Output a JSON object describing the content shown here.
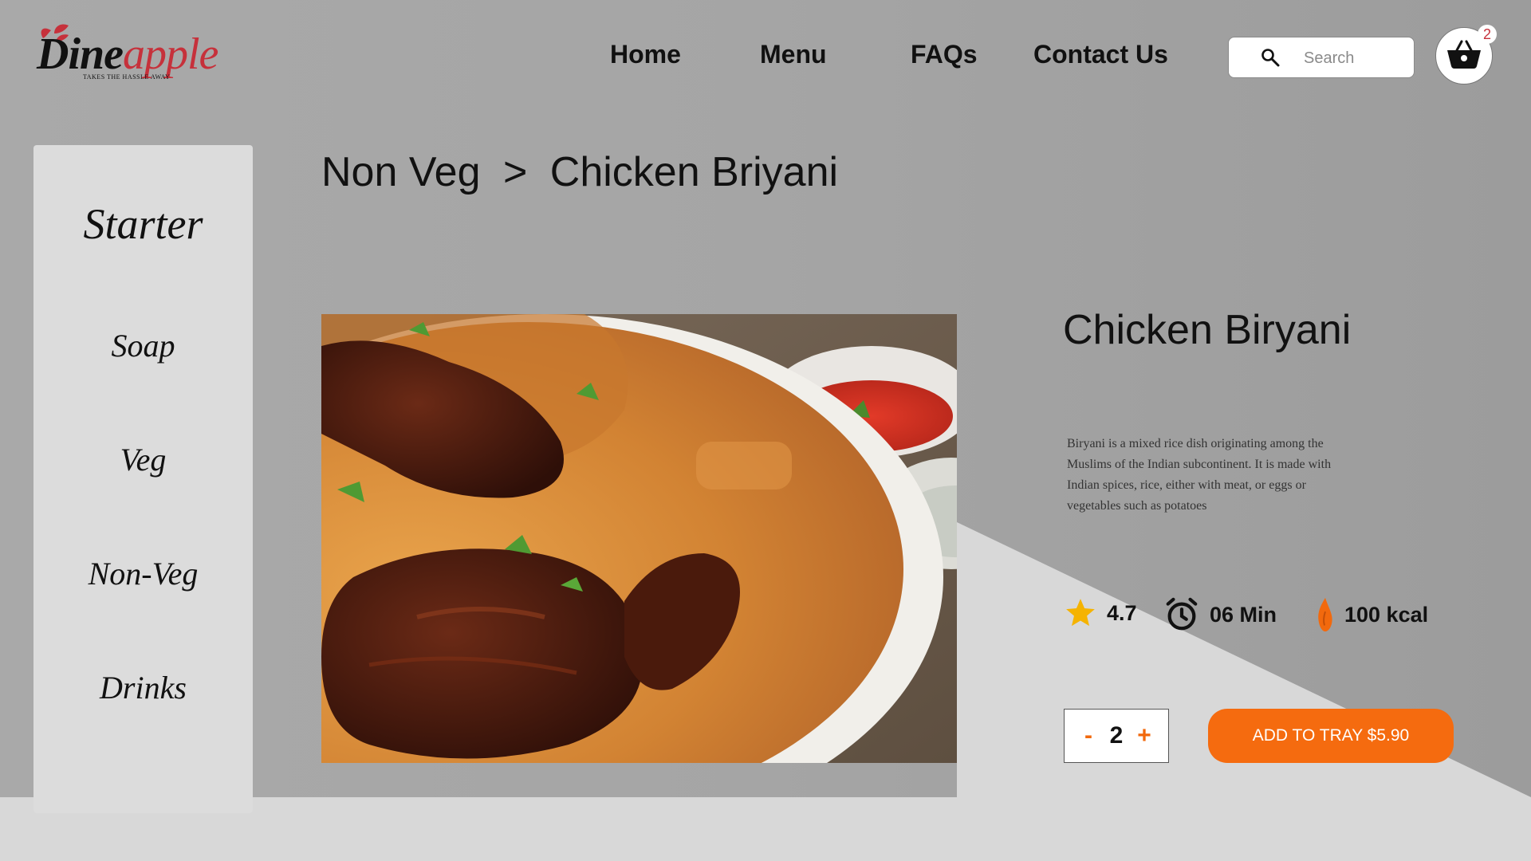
{
  "brand": {
    "name_part1": "Dine",
    "name_part2": "apple",
    "tagline": "TAKES THE HASSLE AWAY",
    "accent_color": "#c6313b"
  },
  "nav": {
    "items": [
      {
        "label": "Home"
      },
      {
        "label": "Menu"
      },
      {
        "label": "FAQs"
      },
      {
        "label": "Contact Us"
      }
    ]
  },
  "search": {
    "placeholder": "Search",
    "value": "",
    "icon": "search-icon"
  },
  "cart": {
    "icon": "basket-icon",
    "count": "2"
  },
  "sidebar": {
    "items": [
      {
        "label": "Starter"
      },
      {
        "label": "Soap"
      },
      {
        "label": "Veg"
      },
      {
        "label": "Non-Veg"
      },
      {
        "label": "Drinks"
      }
    ]
  },
  "breadcrumb": {
    "parent": "Non Veg",
    "separator": ">",
    "current": "Chicken Briyani"
  },
  "dish": {
    "name": "Chicken Biryani",
    "description": "Biryani is a mixed rice dish originating among the Muslims of the Indian subcontinent. It is made with Indian spices, rice, either with meat, or eggs or vegetables such as potatoes",
    "image_alt": "Chicken Biryani plate",
    "rating": "4.7",
    "time": "06 Min",
    "calories": "100 kcal",
    "icons": {
      "rating": "star-icon",
      "time": "alarm-clock-icon",
      "calories": "flame-icon"
    }
  },
  "quantity": {
    "minus": "-",
    "value": "2",
    "plus": "+"
  },
  "actions": {
    "add_to_tray": "ADD TO TRAY $5.90",
    "accent_color": "#f56b0f"
  }
}
